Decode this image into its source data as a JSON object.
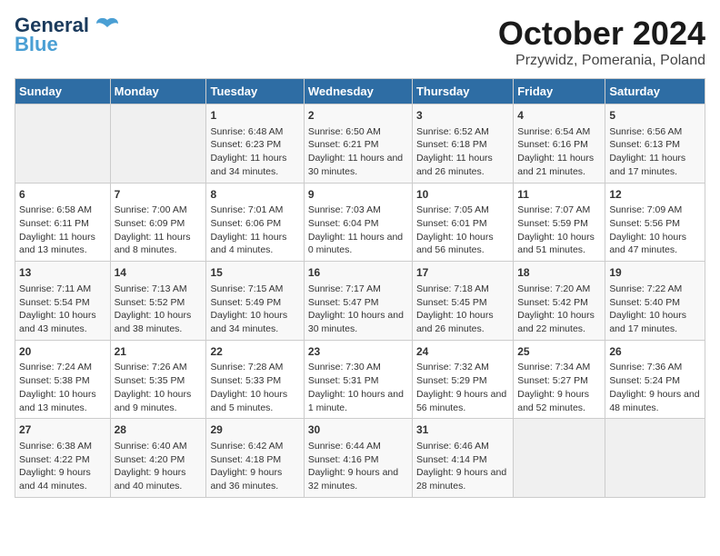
{
  "header": {
    "logo_line1": "General",
    "logo_line2": "Blue",
    "title": "October 2024",
    "subtitle": "Przywidz, Pomerania, Poland"
  },
  "days_of_week": [
    "Sunday",
    "Monday",
    "Tuesday",
    "Wednesday",
    "Thursday",
    "Friday",
    "Saturday"
  ],
  "weeks": [
    [
      {
        "day": "",
        "empty": true
      },
      {
        "day": "",
        "empty": true
      },
      {
        "day": "1",
        "sunrise": "Sunrise: 6:48 AM",
        "sunset": "Sunset: 6:23 PM",
        "daylight": "Daylight: 11 hours and 34 minutes."
      },
      {
        "day": "2",
        "sunrise": "Sunrise: 6:50 AM",
        "sunset": "Sunset: 6:21 PM",
        "daylight": "Daylight: 11 hours and 30 minutes."
      },
      {
        "day": "3",
        "sunrise": "Sunrise: 6:52 AM",
        "sunset": "Sunset: 6:18 PM",
        "daylight": "Daylight: 11 hours and 26 minutes."
      },
      {
        "day": "4",
        "sunrise": "Sunrise: 6:54 AM",
        "sunset": "Sunset: 6:16 PM",
        "daylight": "Daylight: 11 hours and 21 minutes."
      },
      {
        "day": "5",
        "sunrise": "Sunrise: 6:56 AM",
        "sunset": "Sunset: 6:13 PM",
        "daylight": "Daylight: 11 hours and 17 minutes."
      }
    ],
    [
      {
        "day": "6",
        "sunrise": "Sunrise: 6:58 AM",
        "sunset": "Sunset: 6:11 PM",
        "daylight": "Daylight: 11 hours and 13 minutes."
      },
      {
        "day": "7",
        "sunrise": "Sunrise: 7:00 AM",
        "sunset": "Sunset: 6:09 PM",
        "daylight": "Daylight: 11 hours and 8 minutes."
      },
      {
        "day": "8",
        "sunrise": "Sunrise: 7:01 AM",
        "sunset": "Sunset: 6:06 PM",
        "daylight": "Daylight: 11 hours and 4 minutes."
      },
      {
        "day": "9",
        "sunrise": "Sunrise: 7:03 AM",
        "sunset": "Sunset: 6:04 PM",
        "daylight": "Daylight: 11 hours and 0 minutes."
      },
      {
        "day": "10",
        "sunrise": "Sunrise: 7:05 AM",
        "sunset": "Sunset: 6:01 PM",
        "daylight": "Daylight: 10 hours and 56 minutes."
      },
      {
        "day": "11",
        "sunrise": "Sunrise: 7:07 AM",
        "sunset": "Sunset: 5:59 PM",
        "daylight": "Daylight: 10 hours and 51 minutes."
      },
      {
        "day": "12",
        "sunrise": "Sunrise: 7:09 AM",
        "sunset": "Sunset: 5:56 PM",
        "daylight": "Daylight: 10 hours and 47 minutes."
      }
    ],
    [
      {
        "day": "13",
        "sunrise": "Sunrise: 7:11 AM",
        "sunset": "Sunset: 5:54 PM",
        "daylight": "Daylight: 10 hours and 43 minutes."
      },
      {
        "day": "14",
        "sunrise": "Sunrise: 7:13 AM",
        "sunset": "Sunset: 5:52 PM",
        "daylight": "Daylight: 10 hours and 38 minutes."
      },
      {
        "day": "15",
        "sunrise": "Sunrise: 7:15 AM",
        "sunset": "Sunset: 5:49 PM",
        "daylight": "Daylight: 10 hours and 34 minutes."
      },
      {
        "day": "16",
        "sunrise": "Sunrise: 7:17 AM",
        "sunset": "Sunset: 5:47 PM",
        "daylight": "Daylight: 10 hours and 30 minutes."
      },
      {
        "day": "17",
        "sunrise": "Sunrise: 7:18 AM",
        "sunset": "Sunset: 5:45 PM",
        "daylight": "Daylight: 10 hours and 26 minutes."
      },
      {
        "day": "18",
        "sunrise": "Sunrise: 7:20 AM",
        "sunset": "Sunset: 5:42 PM",
        "daylight": "Daylight: 10 hours and 22 minutes."
      },
      {
        "day": "19",
        "sunrise": "Sunrise: 7:22 AM",
        "sunset": "Sunset: 5:40 PM",
        "daylight": "Daylight: 10 hours and 17 minutes."
      }
    ],
    [
      {
        "day": "20",
        "sunrise": "Sunrise: 7:24 AM",
        "sunset": "Sunset: 5:38 PM",
        "daylight": "Daylight: 10 hours and 13 minutes."
      },
      {
        "day": "21",
        "sunrise": "Sunrise: 7:26 AM",
        "sunset": "Sunset: 5:35 PM",
        "daylight": "Daylight: 10 hours and 9 minutes."
      },
      {
        "day": "22",
        "sunrise": "Sunrise: 7:28 AM",
        "sunset": "Sunset: 5:33 PM",
        "daylight": "Daylight: 10 hours and 5 minutes."
      },
      {
        "day": "23",
        "sunrise": "Sunrise: 7:30 AM",
        "sunset": "Sunset: 5:31 PM",
        "daylight": "Daylight: 10 hours and 1 minute."
      },
      {
        "day": "24",
        "sunrise": "Sunrise: 7:32 AM",
        "sunset": "Sunset: 5:29 PM",
        "daylight": "Daylight: 9 hours and 56 minutes."
      },
      {
        "day": "25",
        "sunrise": "Sunrise: 7:34 AM",
        "sunset": "Sunset: 5:27 PM",
        "daylight": "Daylight: 9 hours and 52 minutes."
      },
      {
        "day": "26",
        "sunrise": "Sunrise: 7:36 AM",
        "sunset": "Sunset: 5:24 PM",
        "daylight": "Daylight: 9 hours and 48 minutes."
      }
    ],
    [
      {
        "day": "27",
        "sunrise": "Sunrise: 6:38 AM",
        "sunset": "Sunset: 4:22 PM",
        "daylight": "Daylight: 9 hours and 44 minutes."
      },
      {
        "day": "28",
        "sunrise": "Sunrise: 6:40 AM",
        "sunset": "Sunset: 4:20 PM",
        "daylight": "Daylight: 9 hours and 40 minutes."
      },
      {
        "day": "29",
        "sunrise": "Sunrise: 6:42 AM",
        "sunset": "Sunset: 4:18 PM",
        "daylight": "Daylight: 9 hours and 36 minutes."
      },
      {
        "day": "30",
        "sunrise": "Sunrise: 6:44 AM",
        "sunset": "Sunset: 4:16 PM",
        "daylight": "Daylight: 9 hours and 32 minutes."
      },
      {
        "day": "31",
        "sunrise": "Sunrise: 6:46 AM",
        "sunset": "Sunset: 4:14 PM",
        "daylight": "Daylight: 9 hours and 28 minutes."
      },
      {
        "day": "",
        "empty": true
      },
      {
        "day": "",
        "empty": true
      }
    ]
  ]
}
